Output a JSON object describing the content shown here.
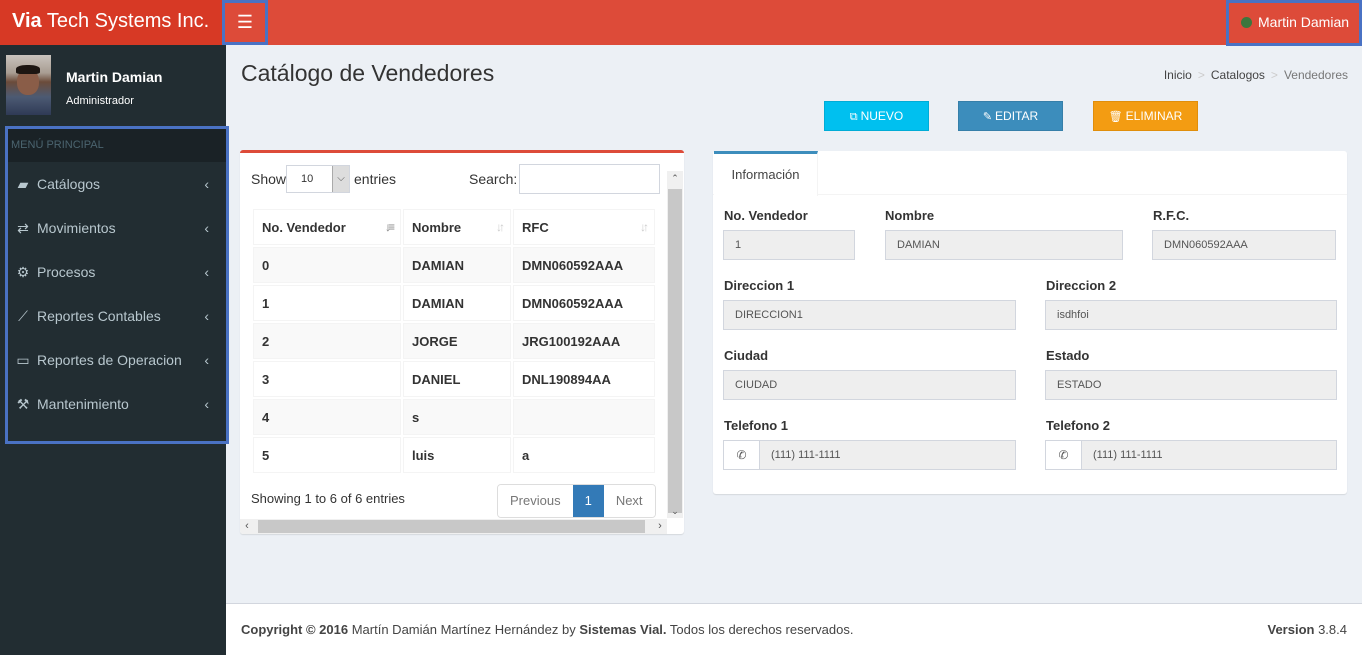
{
  "header": {
    "brand_bold": "Via",
    "brand_rest": " Tech Systems Inc.",
    "toggle_icon": "☰",
    "user_name": "Martin Damian",
    "status_color": "#3c763d"
  },
  "sidebar": {
    "user_name": "Martin Damian",
    "user_role": "Administrador",
    "menu_header": "MENÚ PRINCIPAL",
    "items": [
      {
        "label": "Catálogos",
        "icon": "book-icon",
        "glyph": "▰"
      },
      {
        "label": "Movimientos",
        "icon": "exchange-icon",
        "glyph": "⇄"
      },
      {
        "label": "Procesos",
        "icon": "cogs-icon",
        "glyph": "⚙"
      },
      {
        "label": "Reportes Contables",
        "icon": "line-chart-icon",
        "glyph": "⟋"
      },
      {
        "label": "Reportes de Operacion",
        "icon": "laptop-icon",
        "glyph": "▭"
      },
      {
        "label": "Mantenimiento",
        "icon": "wrench-icon",
        "glyph": "⚒"
      }
    ],
    "chevron": "‹"
  },
  "page": {
    "title": "Catálogo de Vendedores",
    "breadcrumb": [
      "Inicio",
      "Catalogos",
      "Vendedores"
    ],
    "breadcrumb_sep": ">"
  },
  "toolbar": {
    "new_label": "NUEVO",
    "edit_label": "EDITAR",
    "delete_label": "ELIMINAR",
    "new_icon": "⧉",
    "edit_icon": "✎",
    "delete_icon": "🗑"
  },
  "table": {
    "show_label": "Show",
    "entries_label": "entries",
    "page_size": "10",
    "search_label": "Search:",
    "search_value": "",
    "columns": [
      "No. Vendedor",
      "Nombre",
      "RFC"
    ],
    "rows": [
      [
        "0",
        "DAMIAN",
        "DMN060592AAA"
      ],
      [
        "1",
        "DAMIAN",
        "DMN060592AAA"
      ],
      [
        "2",
        "JORGE",
        "JRG100192AAA"
      ],
      [
        "3",
        "DANIEL",
        "DNL190894AA"
      ],
      [
        "4",
        "s",
        ""
      ],
      [
        "5",
        "luis",
        "a"
      ]
    ],
    "info": "Showing 1 to 6 of 6 entries",
    "pagination": {
      "previous": "Previous",
      "current": "1",
      "next": "Next"
    }
  },
  "info_panel": {
    "tab_label": "Información",
    "fields": {
      "no_vendedor": {
        "label": "No. Vendedor",
        "value": "1"
      },
      "nombre": {
        "label": "Nombre",
        "value": "DAMIAN"
      },
      "rfc": {
        "label": "R.F.C.",
        "value": "DMN060592AAA"
      },
      "direccion1": {
        "label": "Direccion 1",
        "value": "DIRECCION1"
      },
      "direccion2": {
        "label": "Direccion 2",
        "value": "isdhfoi"
      },
      "ciudad": {
        "label": "Ciudad",
        "value": "CIUDAD"
      },
      "estado": {
        "label": "Estado",
        "value": "ESTADO"
      },
      "telefono1": {
        "label": "Telefono 1",
        "value": "(111) 111-1111"
      },
      "telefono2": {
        "label": "Telefono 2",
        "value": "(111) 111-1111"
      }
    },
    "phone_icon": "✆"
  },
  "footer": {
    "copyright_bold": "Copyright © 2016",
    "author": " Martín Damián Martínez Hernández by ",
    "company": "Sistemas Vial.",
    "rights": " Todos los derechos reservados.",
    "version_label": "Version",
    "version_value": " 3.8.4"
  }
}
